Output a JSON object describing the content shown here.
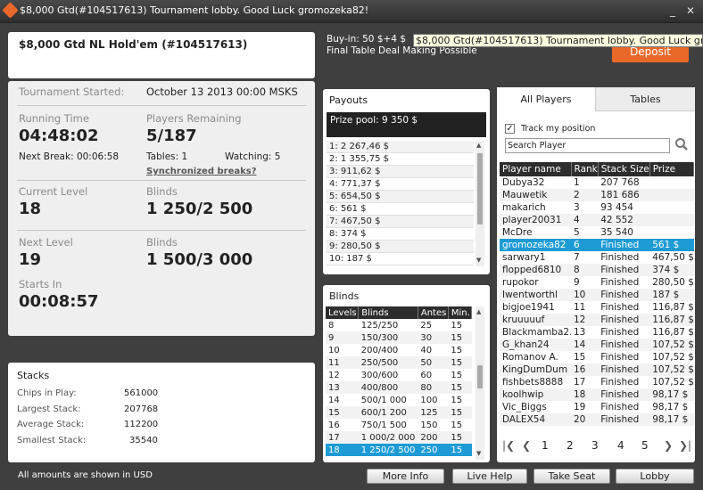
{
  "window": {
    "title": "$8,000 Gtd(#104517613) Tournament lobby. Good Luck gromozeka82!",
    "minimize": "_",
    "close": "✕"
  },
  "header": {
    "tournament_name": "$8,000 Gtd NL Hold'em (#104517613)",
    "buyin": "Buy-in: 50 $+4 $",
    "deal": "Final Table Deal Making Possible",
    "tooltip": "$8,000 Gtd(#104517613) Tournament lobby. Good Luck gromozeka82!",
    "deposit": "Deposit"
  },
  "info": {
    "started_label": "Tournament Started:",
    "started_value": "October 13 2013   00:00 MSKS",
    "running_label": "Running Time",
    "running_value": "04:48:02",
    "players_label": "Players Remaining",
    "players_value": "5/187",
    "next_break": "Next Break: 00:06:58",
    "tables": "Tables: 1",
    "watching": "Watching: 5",
    "sync_breaks": "Synchronized breaks?",
    "current_level_label": "Current Level",
    "current_level_value": "18",
    "current_blinds_label": "Blinds",
    "current_blinds_value": "1 250/2 500",
    "next_level_label": "Next Level",
    "next_level_value": "19",
    "next_blinds_label": "Blinds",
    "next_blinds_value": "1 500/3 000",
    "starts_in_label": "Starts In",
    "starts_in_value": "00:08:57"
  },
  "stacks": {
    "title": "Stacks",
    "rows": [
      {
        "label": "Chips in Play:",
        "value": "561000"
      },
      {
        "label": "Largest Stack:",
        "value": "207768"
      },
      {
        "label": "Average Stack:",
        "value": "112200"
      },
      {
        "label": "Smallest Stack:",
        "value": "35540"
      }
    ]
  },
  "payouts": {
    "title": "Payouts",
    "prize_pool": "Prize pool: 9 350 $",
    "rows": [
      "1: 2 267,46 $",
      "2: 1 355,75 $",
      "3: 911,62 $",
      "4: 771,37 $",
      "5: 654,50 $",
      "6: 561 $",
      "7: 467,50 $",
      "8: 374 $",
      "9: 280,50 $",
      "10: 187 $"
    ]
  },
  "blinds": {
    "title": "Blinds",
    "headers": [
      "Levels",
      "Blinds",
      "Antes",
      "Min."
    ],
    "rows": [
      [
        "8",
        "125/250",
        "25",
        "15"
      ],
      [
        "9",
        "150/300",
        "30",
        "15"
      ],
      [
        "10",
        "200/400",
        "40",
        "15"
      ],
      [
        "11",
        "250/500",
        "50",
        "15"
      ],
      [
        "12",
        "300/600",
        "60",
        "15"
      ],
      [
        "13",
        "400/800",
        "80",
        "15"
      ],
      [
        "14",
        "500/1 000",
        "100",
        "15"
      ],
      [
        "15",
        "600/1 200",
        "125",
        "15"
      ],
      [
        "16",
        "750/1 500",
        "150",
        "15"
      ],
      [
        "17",
        "1 000/2 000",
        "200",
        "15"
      ],
      [
        "18",
        "1 250/2 500",
        "250",
        "15"
      ]
    ],
    "selected_index": 10
  },
  "players": {
    "tab_all": "All Players",
    "tab_tables": "Tables",
    "track_label": "Track my position",
    "search_placeholder": "Search Player",
    "headers": [
      "Player name",
      "Rank",
      "Stack Size",
      "Prize"
    ],
    "rows": [
      [
        "Dubya32",
        "1",
        "207 768",
        ""
      ],
      [
        "Mauwetik",
        "2",
        "181 686",
        ""
      ],
      [
        "makarich",
        "3",
        "93 454",
        ""
      ],
      [
        "player20031",
        "4",
        "42 552",
        ""
      ],
      [
        "McDre",
        "5",
        "35 540",
        ""
      ],
      [
        "gromozeka82",
        "6",
        "Finished",
        "561 $"
      ],
      [
        "sarwary1",
        "7",
        "Finished",
        "467,50 $"
      ],
      [
        "flopped6810",
        "8",
        "Finished",
        "374 $"
      ],
      [
        "rupokor",
        "9",
        "Finished",
        "280,50 $"
      ],
      [
        "Iwentworthl",
        "10",
        "Finished",
        "187 $"
      ],
      [
        "bigjoe1941",
        "11",
        "Finished",
        "116,87 $"
      ],
      [
        "kruuuuuf",
        "12",
        "Finished",
        "116,87 $"
      ],
      [
        "Blackmamba2...",
        "13",
        "Finished",
        "116,87 $"
      ],
      [
        "G_khan24",
        "14",
        "Finished",
        "107,52 $"
      ],
      [
        "Romanov A.",
        "15",
        "Finished",
        "107,52 $"
      ],
      [
        "KingDumDum",
        "16",
        "Finished",
        "107,52 $"
      ],
      [
        "fishbets8888",
        "17",
        "Finished",
        "107,52 $"
      ],
      [
        "koolhwip",
        "18",
        "Finished",
        "98,17 $"
      ],
      [
        "Vic_Biggs",
        "19",
        "Finished",
        "98,17 $"
      ],
      [
        "DALEX54",
        "20",
        "Finished",
        "98,17 $"
      ]
    ],
    "selected_index": 5,
    "pager": {
      "first": "|❮",
      "prev": "❮",
      "pages": [
        "1",
        "2",
        "3",
        "4",
        "5"
      ],
      "next": "❯",
      "last": "❯|"
    }
  },
  "footer": {
    "note": "All amounts are shown in USD",
    "more_info": "More Info",
    "live_help": "Live Help",
    "take_seat": "Take Seat",
    "lobby": "Lobby"
  },
  "colors": {
    "accent": "#e8682a",
    "selected": "#1e9bd5"
  }
}
